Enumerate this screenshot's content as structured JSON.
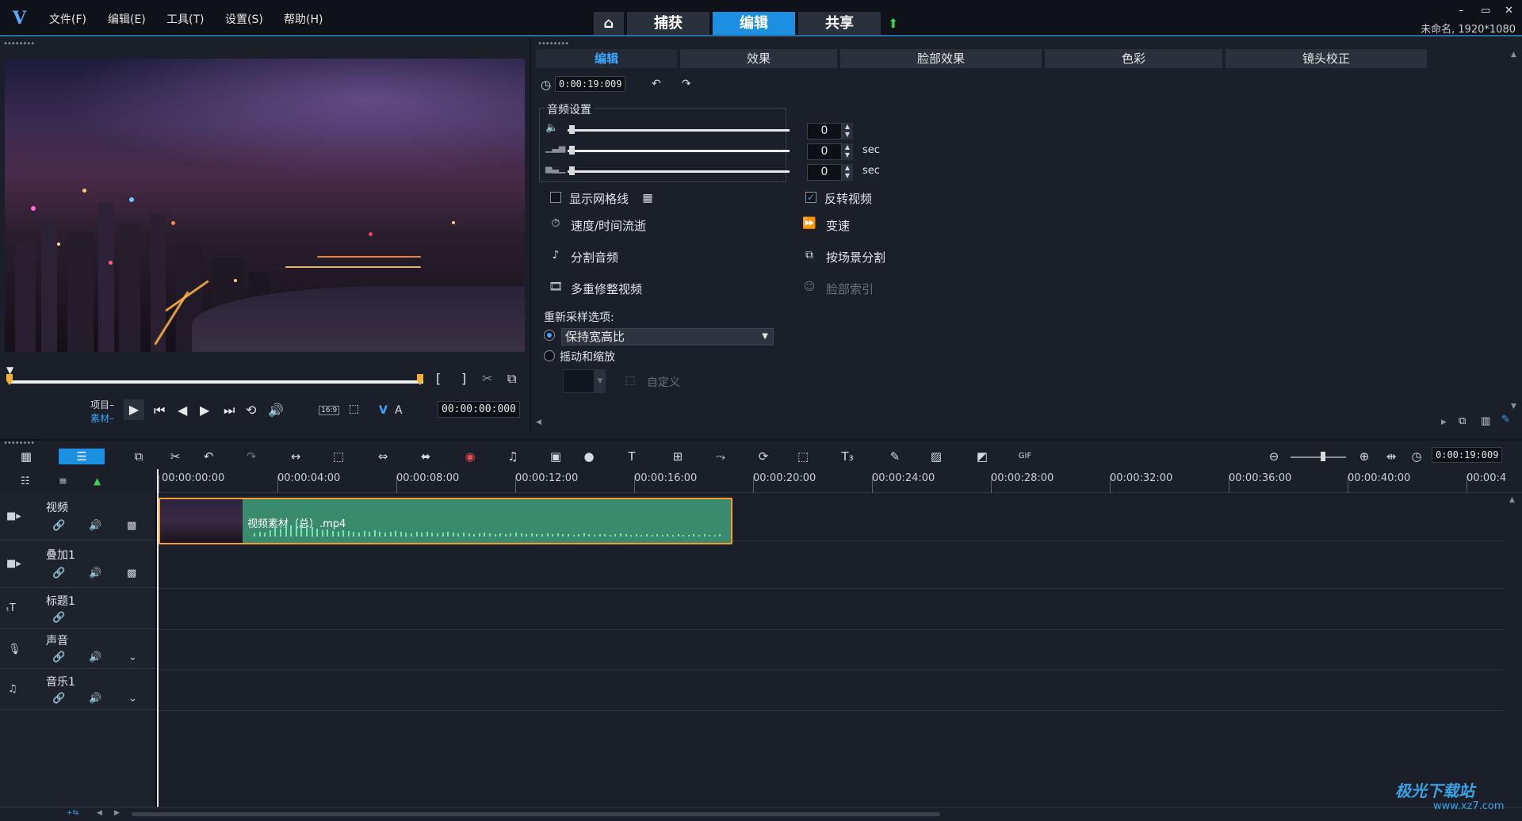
{
  "app": {
    "menus": [
      "文件(F)",
      "编辑(E)",
      "工具(T)",
      "设置(S)",
      "帮助(H)"
    ],
    "nav_tabs": [
      "捕获",
      "编辑",
      "共享"
    ],
    "active_nav": "编辑",
    "project_info": "未命名, 1920*1080",
    "window_buttons": [
      "–",
      "▭",
      "✕"
    ]
  },
  "player": {
    "mode_project": "项目–",
    "mode_clip": "素材–",
    "aspect": "16:9",
    "timecode": "00:00:00:000",
    "trim_in": "[",
    "trim_out": "]",
    "letters": [
      "V",
      "A"
    ]
  },
  "options": {
    "tabs": [
      "编辑",
      "效果",
      "脸部效果",
      "色彩",
      "镜头校正"
    ],
    "active_tab": "编辑",
    "duration": "0:00:19:009",
    "audio_group_label": "音频设置",
    "audio_rows": [
      {
        "value": "0",
        "unit": ""
      },
      {
        "value": "0",
        "unit": "sec"
      },
      {
        "value": "0",
        "unit": "sec"
      }
    ],
    "show_grid_label": "显示网格线",
    "show_grid_checked": false,
    "reverse_label": "反转视频",
    "reverse_checked": true,
    "speed_label": "速度/时间流逝",
    "varspeed_label": "变速",
    "split_audio_label": "分割音频",
    "scene_split_label": "按场景分割",
    "multitrim_label": "多重修整视频",
    "face_index_label": "脸部索引",
    "resample_label": "重新采样选项:",
    "keep_aspect_label": "保持宽高比",
    "pan_zoom_label": "摇动和缩放",
    "custom_label": "自定义"
  },
  "timeline": {
    "timecode": "0:00:19:009",
    "ruler": [
      "00:00:00:00",
      "00:00:04:00",
      "00:00:08:00",
      "00:00:12:00",
      "00:00:16:00",
      "00:00:20:00",
      "00:00:24:00",
      "00:00:28:00",
      "00:00:32:00",
      "00:00:36:00",
      "00:00:40:00",
      "00:00:4"
    ],
    "tracks": [
      "视频",
      "叠加1",
      "标题1",
      "声音",
      "音乐1"
    ],
    "clip_name": "视频素材（总）.mp4"
  },
  "watermark": {
    "text": "极光下载站",
    "url": "www.xz7.com"
  },
  "colors": {
    "accent": "#1c8fe3",
    "clip": "#3a8a6e",
    "clip_border": "#f2a033",
    "waveform": "#7fe0b8"
  }
}
